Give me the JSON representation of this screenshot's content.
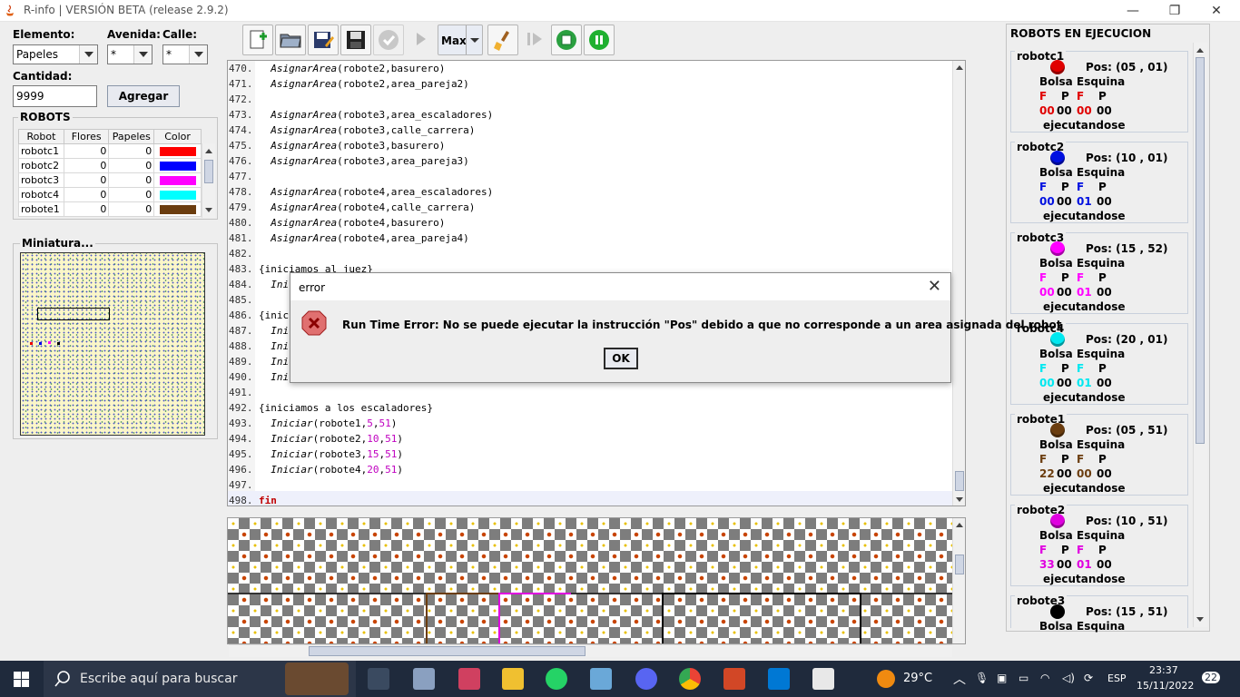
{
  "window": {
    "title": "R-info  |  VERSIÓN BETA (release 2.9.2)"
  },
  "controls": {
    "elemento_label": "Elemento:",
    "elemento_value": "Papeles",
    "avenida_label": "Avenida:",
    "avenida_value": "*",
    "calle_label": "Calle:",
    "calle_value": "*",
    "cantidad_label": "Cantidad:",
    "cantidad_value": "9999",
    "agregar_label": "Agregar"
  },
  "robots_table": {
    "title": "ROBOTS",
    "headers": [
      "Robot",
      "Flores",
      "Papeles",
      "Color"
    ],
    "rows": [
      {
        "robot": "robotc1",
        "flores": "0",
        "papeles": "0",
        "color": "#ff0000"
      },
      {
        "robot": "robotc2",
        "flores": "0",
        "papeles": "0",
        "color": "#0000ff"
      },
      {
        "robot": "robotc3",
        "flores": "0",
        "papeles": "0",
        "color": "#ff00ff"
      },
      {
        "robot": "robotc4",
        "flores": "0",
        "papeles": "0",
        "color": "#00ffff"
      },
      {
        "robot": "robote1",
        "flores": "0",
        "papeles": "0",
        "color": "#6b3d0f"
      }
    ]
  },
  "miniatura": {
    "title": "Miniatura..."
  },
  "toolbar": {
    "max_label": "Max"
  },
  "code": [
    {
      "n": "470.",
      "t": "AsignarArea(robote2,basurero)"
    },
    {
      "n": "471.",
      "t": "AsignarArea(robote2,area_pareja2)"
    },
    {
      "n": "472.",
      "t": ""
    },
    {
      "n": "473.",
      "t": "AsignarArea(robote3,area_escaladores)"
    },
    {
      "n": "474.",
      "t": "AsignarArea(robote3,calle_carrera)"
    },
    {
      "n": "475.",
      "t": "AsignarArea(robote3,basurero)"
    },
    {
      "n": "476.",
      "t": "AsignarArea(robote3,area_pareja3)"
    },
    {
      "n": "477.",
      "t": ""
    },
    {
      "n": "478.",
      "t": "AsignarArea(robote4,area_escaladores)"
    },
    {
      "n": "479.",
      "t": "AsignarArea(robote4,calle_carrera)"
    },
    {
      "n": "480.",
      "t": "AsignarArea(robote4,basurero)"
    },
    {
      "n": "481.",
      "t": "AsignarArea(robote4,area_pareja4)"
    },
    {
      "n": "482.",
      "t": ""
    },
    {
      "n": "483.",
      "t": "{iniciamos al juez}"
    },
    {
      "n": "484.",
      "t": "Ini"
    },
    {
      "n": "485.",
      "t": ""
    },
    {
      "n": "486.",
      "t": "{inic"
    },
    {
      "n": "487.",
      "t": "Inic"
    },
    {
      "n": "488.",
      "t": "Inic"
    },
    {
      "n": "489.",
      "t": "Inic"
    },
    {
      "n": "490.",
      "t": "Inic"
    },
    {
      "n": "491.",
      "t": ""
    },
    {
      "n": "492.",
      "t": "{iniciamos a los escaladores}"
    },
    {
      "n": "493.",
      "t": "Iniciar(robote1,5,51)"
    },
    {
      "n": "494.",
      "t": "Iniciar(robote2,10,51)"
    },
    {
      "n": "495.",
      "t": "Iniciar(robote3,15,51)"
    },
    {
      "n": "496.",
      "t": "Iniciar(robote4,20,51)"
    },
    {
      "n": "497.",
      "t": ""
    },
    {
      "n": "498.",
      "t": "fin"
    }
  ],
  "running": {
    "title": "ROBOTS EN EJECUCION",
    "robots": [
      {
        "name": "robotc1",
        "color": "#e00000",
        "pos": "Pos:  (05 , 01)",
        "bolsa_f": "00",
        "bolsa_p": "00",
        "esq_f": "00",
        "esq_p": "00",
        "status": "ejecutandose"
      },
      {
        "name": "robotc2",
        "color": "#0010e0",
        "pos": "Pos:  (10 , 01)",
        "bolsa_f": "00",
        "bolsa_p": "00",
        "esq_f": "01",
        "esq_p": "00",
        "status": "ejecutandose"
      },
      {
        "name": "robotc3",
        "color": "#ff00ff",
        "pos": "Pos:  (15 , 52)",
        "bolsa_f": "00",
        "bolsa_p": "00",
        "esq_f": "01",
        "esq_p": "00",
        "status": "ejecutandose"
      },
      {
        "name": "robotc4",
        "color": "#00e8f0",
        "pos": "Pos:  (20 , 01)",
        "bolsa_f": "00",
        "bolsa_p": "00",
        "esq_f": "01",
        "esq_p": "00",
        "status": "ejecutandose"
      },
      {
        "name": "robote1",
        "color": "#6b3d0f",
        "pos": "Pos:  (05 , 51)",
        "bolsa_f": "22",
        "bolsa_p": "00",
        "esq_f": "00",
        "esq_p": "00",
        "status": "ejecutandose"
      },
      {
        "name": "robote2",
        "color": "#e000e0",
        "pos": "Pos:  (10 , 51)",
        "bolsa_f": "33",
        "bolsa_p": "00",
        "esq_f": "01",
        "esq_p": "00",
        "status": "ejecutandose"
      },
      {
        "name": "robote3",
        "color": "#000000",
        "pos": "Pos:  (15 , 51)",
        "bolsa_f": "",
        "bolsa_p": "",
        "esq_f": "",
        "esq_p": "",
        "status": ""
      }
    ],
    "bolsa_label": "Bolsa",
    "esquina_label": "Esquina",
    "f_label": "F",
    "p_label": "P"
  },
  "dialog": {
    "title": "error",
    "message": "Run Time Error: No se puede ejecutar la instrucción \"Pos\" debido a que no corresponde a un area asignada del robot",
    "ok_label": "OK"
  },
  "taskbar": {
    "search_placeholder": "Escribe aquí para buscar",
    "temperature": "29°C",
    "language": "ESP",
    "time": "23:37",
    "date": "15/11/2022",
    "notifications": "22"
  }
}
